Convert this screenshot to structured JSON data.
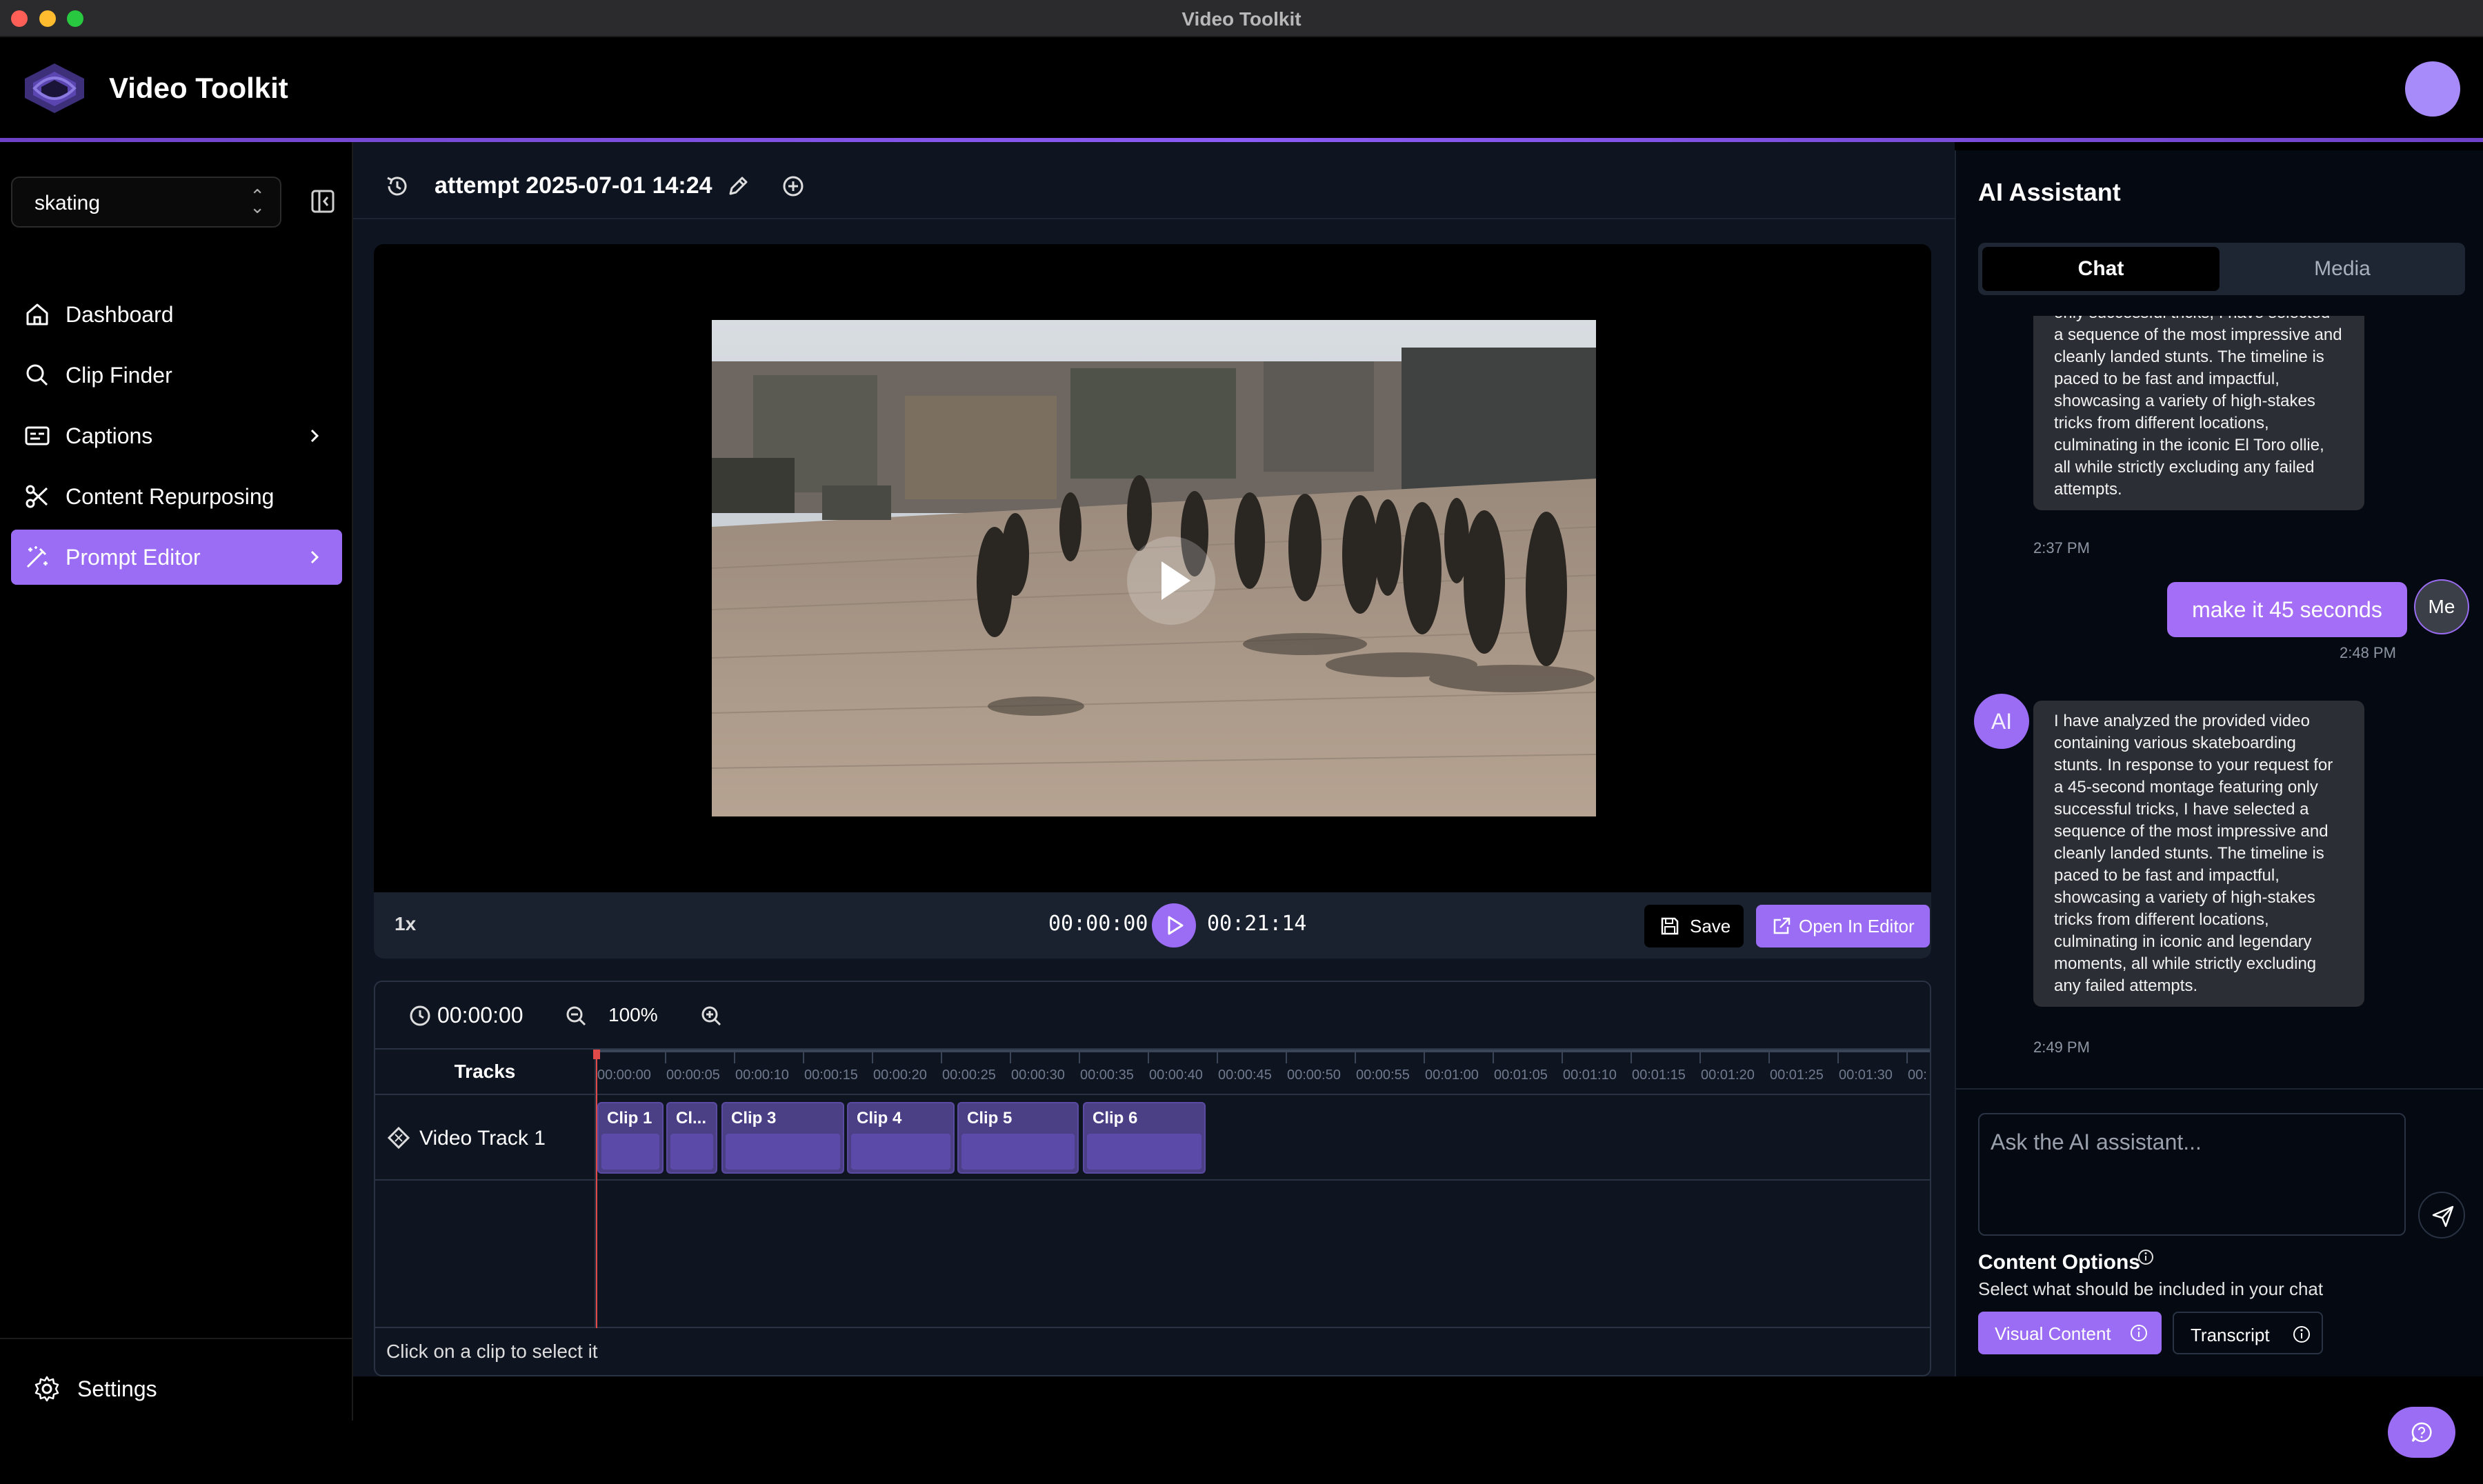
{
  "window": {
    "title": "Video Toolkit"
  },
  "app": {
    "name": "Video Toolkit"
  },
  "sidebar": {
    "project": "skating",
    "items": [
      {
        "label": "Dashboard",
        "icon": "home-icon"
      },
      {
        "label": "Clip Finder",
        "icon": "search-icon"
      },
      {
        "label": "Captions",
        "icon": "captions-icon",
        "has_submenu": true
      },
      {
        "label": "Content Repurposing",
        "icon": "scissors-icon"
      },
      {
        "label": "Prompt Editor",
        "icon": "magic-wand-icon",
        "active": true,
        "has_submenu": true
      }
    ],
    "settings_label": "Settings"
  },
  "editor": {
    "title": "attempt 2025-07-01 14:24",
    "speed": "1x",
    "current_time": "00:00:00",
    "total_time": "00:21:14",
    "save_label": "Save",
    "open_editor_label": "Open In Editor"
  },
  "timeline": {
    "time": "00:00:00",
    "zoom": "100%",
    "tracks_header": "Tracks",
    "track_name": "Video Track 1",
    "ticks": [
      "00:00:00",
      "00:00:05",
      "00:00:10",
      "00:00:15",
      "00:00:20",
      "00:00:25",
      "00:00:30",
      "00:00:35",
      "00:00:40",
      "00:00:45",
      "00:00:50",
      "00:00:55",
      "00:01:00",
      "00:01:05",
      "00:01:10",
      "00:01:15",
      "00:01:20",
      "00:01:25",
      "00:01:30",
      "00:"
    ],
    "clips": [
      "Clip 1",
      "Cl...",
      "Clip 3",
      "Clip 4",
      "Clip 5",
      "Clip 6"
    ],
    "status": "Click on a clip to select it"
  },
  "ai": {
    "title": "AI Assistant",
    "tabs": [
      "Chat",
      "Media"
    ],
    "messages": [
      {
        "from": "ai",
        "text": "only successful tricks, I have selected a sequence of the most impressive and cleanly landed stunts. The timeline is paced to be fast and impactful, showcasing a variety of high-stakes tricks from different locations, culminating in the iconic El Toro ollie, all while strictly excluding any failed attempts.",
        "time": "2:37 PM"
      },
      {
        "from": "me",
        "text": "make it 45 seconds",
        "time": "2:48 PM",
        "avatar": "Me"
      },
      {
        "from": "ai",
        "avatar": "AI",
        "text": "I have analyzed the provided video containing various skateboarding stunts. In response to your request for a 45-second montage featuring only successful tricks, I have selected a sequence of the most impressive and cleanly landed stunts. The timeline is paced to be fast and impactful, showcasing a variety of high-stakes tricks from different locations, culminating in iconic and legendary moments, all while strictly excluding any failed attempts.",
        "time": "2:49 PM"
      }
    ],
    "input_placeholder": "Ask the AI assistant...",
    "content_options_title": "Content Options",
    "content_options_desc": "Select what should be included in your chat",
    "chips": [
      "Visual Content",
      "Transcript"
    ]
  },
  "colors": {
    "accent": "#9b6cf4",
    "background": "#000000",
    "panel": "#0f1520"
  }
}
